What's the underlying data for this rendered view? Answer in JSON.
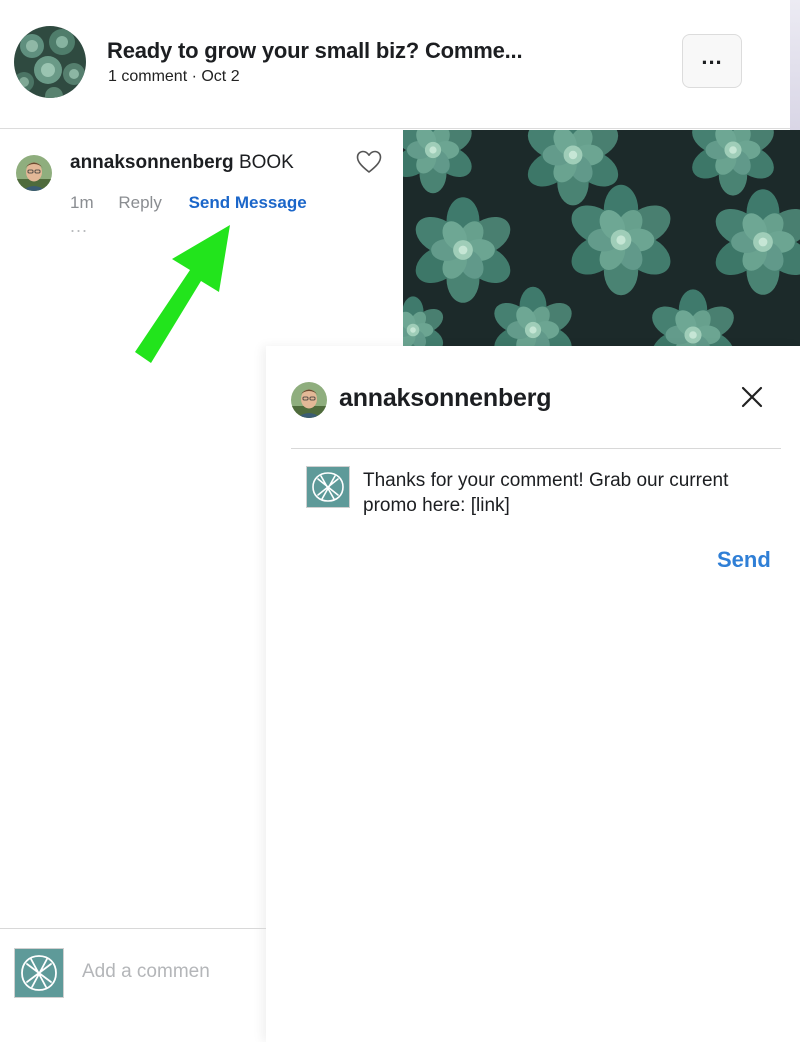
{
  "header": {
    "title": "Ready to grow your small biz? Comme...",
    "meta": "1 comment · Oct 2",
    "more_label": "..."
  },
  "comment": {
    "username": "annaksonnenberg",
    "text": "BOOK",
    "time": "1m",
    "reply_label": "Reply",
    "send_message_label": "Send Message",
    "more_label": "..."
  },
  "dm": {
    "username": "annaksonnenberg",
    "message": "Thanks for your comment! Grab our current promo here: [link]",
    "send_label": "Send"
  },
  "composer": {
    "placeholder": "Add a commen"
  },
  "icons": {
    "heart": "heart-outline-icon",
    "close": "close-x-icon",
    "page": "page-logo-icon",
    "arrow": "green-annotation-arrow"
  },
  "colors": {
    "link_blue": "#1b66c9",
    "send_blue": "#2f7fd6",
    "arrow_green": "#22e41c",
    "page_teal": "#5e9a99"
  }
}
